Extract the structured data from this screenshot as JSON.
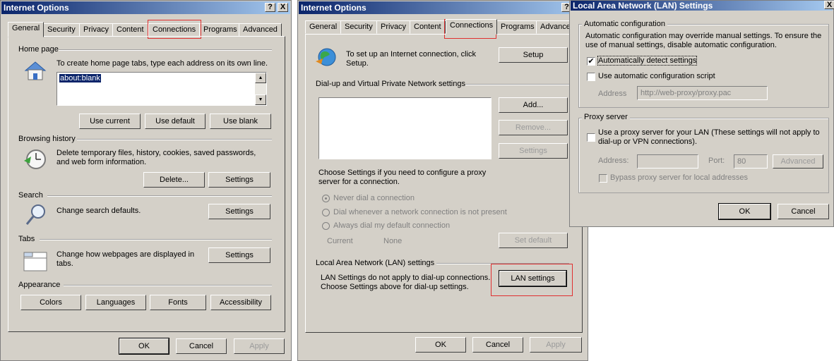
{
  "win1": {
    "title": "Internet Options",
    "help_button": "?",
    "close_button": "X",
    "tabs": [
      "General",
      "Security",
      "Privacy",
      "Content",
      "Connections",
      "Programs",
      "Advanced"
    ],
    "home_page": {
      "heading": "Home page",
      "desc": "To create home page tabs, type each address on its own line.",
      "value": "about:blank",
      "use_current": "Use current",
      "use_default": "Use default",
      "use_blank": "Use blank"
    },
    "browsing_history": {
      "heading": "Browsing history",
      "desc_line1": "Delete temporary files, history, cookies, saved passwords,",
      "desc_line2": "and web form information.",
      "delete": "Delete...",
      "settings": "Settings"
    },
    "search": {
      "heading": "Search",
      "desc": "Change search defaults.",
      "settings": "Settings"
    },
    "tabs_section": {
      "heading": "Tabs",
      "desc_line1": "Change how webpages are displayed in",
      "desc_line2": "tabs.",
      "settings": "Settings"
    },
    "appearance": {
      "heading": "Appearance",
      "colors": "Colors",
      "languages": "Languages",
      "fonts": "Fonts",
      "accessibility": "Accessibility"
    },
    "ok": "OK",
    "cancel": "Cancel",
    "apply": "Apply"
  },
  "win2": {
    "title": "Internet Options",
    "tabs": [
      "General",
      "Security",
      "Privacy",
      "Content",
      "Connections",
      "Programs",
      "Advance"
    ],
    "setup_desc_line1": "To set up an Internet connection, click",
    "setup_desc_line2": "Setup.",
    "setup": "Setup",
    "dialup_heading": "Dial-up and Virtual Private Network settings",
    "add": "Add...",
    "remove": "Remove...",
    "settings": "Settings",
    "proxy_desc_line1": "Choose Settings if you need to configure a proxy",
    "proxy_desc_line2": "server for a connection.",
    "radio_never": "Never dial a connection",
    "radio_whenever": "Dial whenever a network connection is not present",
    "radio_always": "Always dial my default connection",
    "current_label": "Current",
    "current_value": "None",
    "set_default": "Set default",
    "lan_heading": "Local Area Network (LAN) settings",
    "lan_desc_line1": "LAN Settings do not apply to dial-up connections.",
    "lan_desc_line2": "Choose Settings above for dial-up settings.",
    "lan_settings": "LAN settings",
    "ok": "OK",
    "cancel": "Cancel",
    "apply": "Apply"
  },
  "win3": {
    "title": "Local Area Network (LAN) Settings",
    "close_button": "X",
    "auto_config_heading": "Automatic configuration",
    "auto_desc_line1": "Automatic configuration may override manual settings.  To ensure the",
    "auto_desc_line2": "use of manual settings, disable automatic configuration.",
    "auto_detect": "Automatically detect settings",
    "auto_script": "Use automatic configuration script",
    "address_label": "Address",
    "address_value": "http://web-proxy/proxy.pac",
    "proxy_heading": "Proxy server",
    "use_proxy_line1": "Use a proxy server for your LAN (These settings will not apply to",
    "use_proxy_line2": "dial-up or VPN connections).",
    "proxy_address_label": "Address:",
    "port_label": "Port:",
    "port_value": "80",
    "advanced": "Advanced",
    "bypass": "Bypass proxy server for local addresses",
    "ok": "OK",
    "cancel": "Cancel"
  },
  "colors": {
    "title_start": "#0a246a",
    "title_end": "#a6caf0",
    "highlight": "#e03030",
    "dialog_bg": "#d4d0c8"
  }
}
